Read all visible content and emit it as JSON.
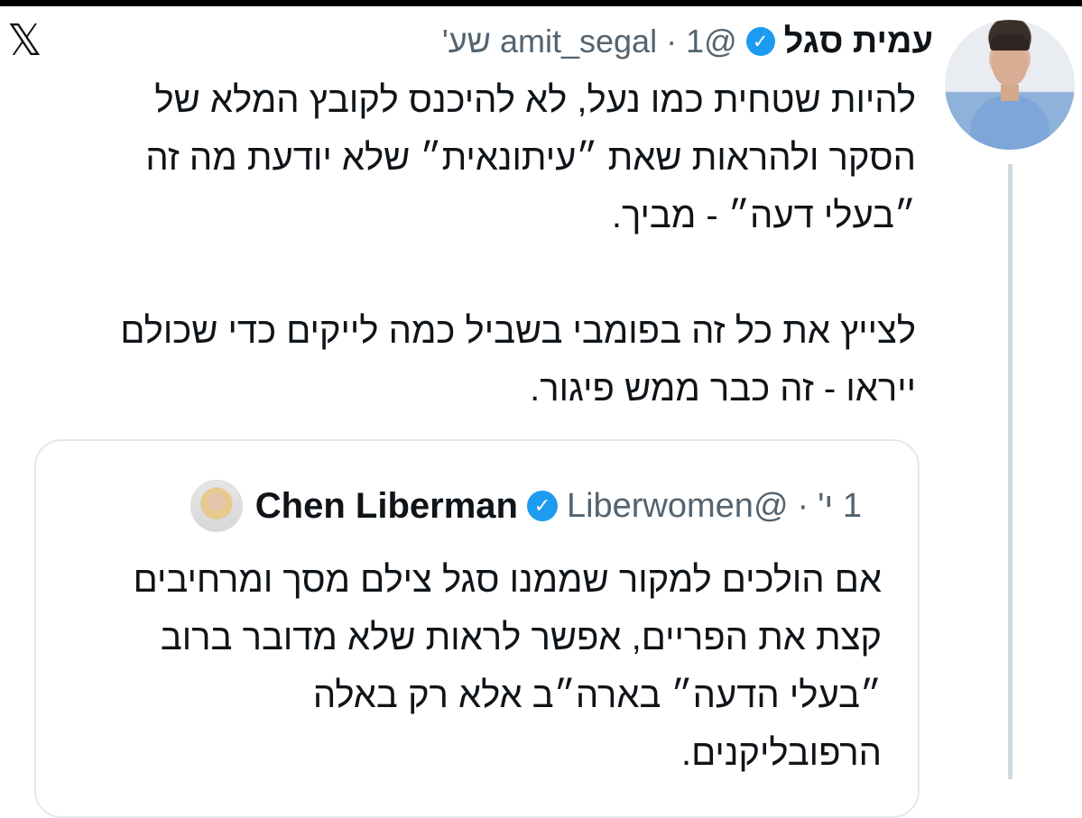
{
  "author": {
    "name": "עמית סגל",
    "handle": "@amit_segal",
    "time": "1 שע'",
    "separator": "·",
    "avatar_icon": "profile-photo",
    "verified_icon": "verified-badge",
    "brand_icon": "x-logo"
  },
  "brand": {
    "logo_glyph": "𝕏"
  },
  "tweet": {
    "lines": [
      "להיות שטחית כמו נעל, לא להיכנס לקובץ המלא של",
      "הסקר ולהראות שאת ״עיתונאית״ שלא יודעת מה זה",
      "״בעלי דעה״ - מביך.",
      "לצייץ את כל זה בפומבי בשביל כמה לייקים כדי שכולם",
      "ייראו - זה כבר ממש פיגור."
    ]
  },
  "quoted": {
    "name": "Chen Liberman",
    "handle": "@Liberwomen",
    "separator": "·",
    "time": "1 י'",
    "lines": [
      "אם הולכים למקור שממנו סגל צילם מסך ומרחיבים",
      "קצת את הפריים, אפשר לראות שלא מדובר ברוב",
      "״בעלי הדעה״ בארה״ב אלא רק באלה",
      "הרפובליקנים."
    ]
  },
  "colors": {
    "verified": "#1d9bf0",
    "text": "#0f1419",
    "secondary": "#536471",
    "border": "#e2e8ec"
  }
}
